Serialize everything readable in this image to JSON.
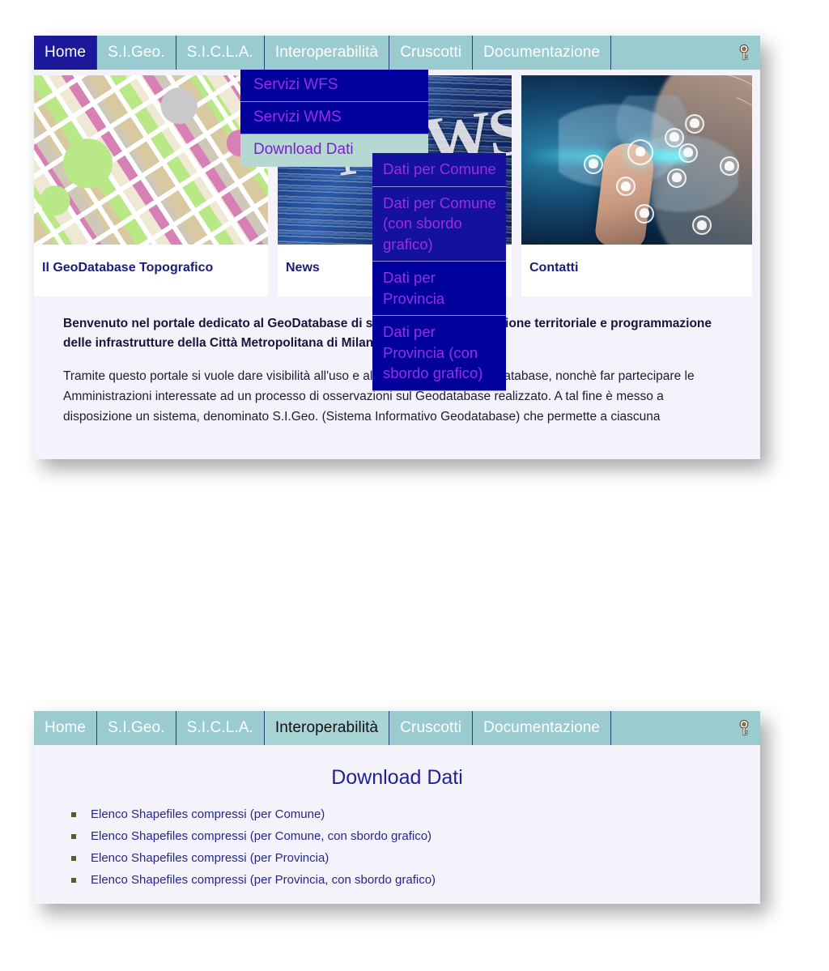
{
  "navbar_top": {
    "items": [
      {
        "label": "Home",
        "state": "active-dark"
      },
      {
        "label": "S.I.Geo.",
        "state": "normal"
      },
      {
        "label": "S.I.C.L.A.",
        "state": "normal"
      },
      {
        "label": "Interoperabilità",
        "state": "open"
      },
      {
        "label": "Cruscotti",
        "state": "normal"
      },
      {
        "label": "Documentazione",
        "state": "normal"
      }
    ],
    "key_icon": "key-icon"
  },
  "dropdown": {
    "items": [
      {
        "label": "Servizi WFS",
        "hovered": false
      },
      {
        "label": "Servizi WMS",
        "hovered": false
      },
      {
        "label": "Download Dati",
        "hovered": true
      }
    ]
  },
  "submenu": {
    "items": [
      {
        "label": "Dati per Comune"
      },
      {
        "label": "Dati per Comune (con sbordo grafico)"
      },
      {
        "label": "Dati per Provincia"
      },
      {
        "label": "Dati per Provincia (con sbordo grafico)"
      }
    ]
  },
  "cards": [
    {
      "title": "Il GeoDatabase Topografico",
      "image": "topographic-map-image"
    },
    {
      "title": "News",
      "image": "news-image",
      "image_word": "NEWS"
    },
    {
      "title": "Contatti",
      "image": "global-network-image"
    }
  ],
  "main_text": {
    "lead": "Benvenuto nel portale dedicato al GeoDatabase di supporto alla pianificazione territoriale e programmazione delle  infrastrutture della Città Metropolitana di Milano.",
    "paragraph": "Tramite questo portale si vuole dare visibilità all'uso e alle potenzialità del Geodatabase, nonchè far partecipare le Amministrazioni interessate ad un processo di osservazioni sul Geodatabase realizzato. A tal fine è messo a disposizione un sistema, denominato S.I.Geo. (Sistema Informativo Geodatabase) che permette a ciascuna"
  },
  "navbar_bottom": {
    "items": [
      {
        "label": "Home",
        "state": "normal"
      },
      {
        "label": "S.I.Geo.",
        "state": "normal"
      },
      {
        "label": "S.I.C.L.A.",
        "state": "normal"
      },
      {
        "label": "Interoperabilità",
        "state": "active-light"
      },
      {
        "label": "Cruscotti",
        "state": "normal"
      },
      {
        "label": "Documentazione",
        "state": "normal"
      }
    ],
    "key_icon": "key-icon"
  },
  "download_page": {
    "title": "Download Dati",
    "links": [
      "Elenco Shapefiles compressi (per Comune)",
      "Elenco Shapefiles compressi (per Comune, con sbordo grafico)",
      "Elenco Shapefiles compressi (per Provincia)",
      "Elenco Shapefiles compressi (per Provincia, con sbordo grafico)"
    ]
  },
  "colors": {
    "navbar_teal": "#9ACCCF",
    "navbar_active_navy": "#1B199A",
    "dropdown_navy": "#00009D",
    "dropdown_text_purple": "#9B2EE0",
    "dropdown_hover_teal": "#B6D8D2",
    "panel_bg": "#F4F3FB",
    "heading_navy": "#21219C",
    "link_navy": "#26268F"
  }
}
